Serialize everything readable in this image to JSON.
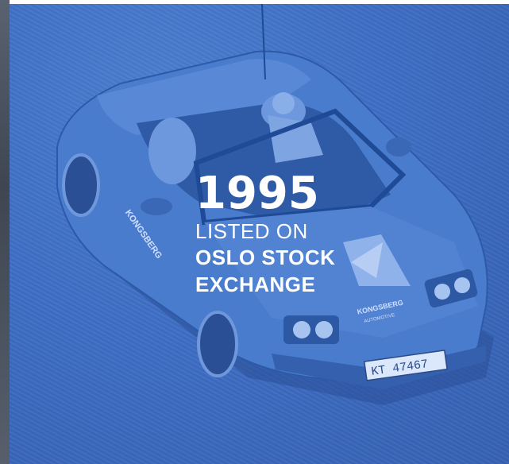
{
  "milestone": {
    "year": "1995",
    "line1": "LISTED ON",
    "line2": "OSLO STOCK",
    "line3": "EXCHANGE"
  },
  "photo": {
    "plate": "KT 47467",
    "brand_hood": "KONGSBERG",
    "brand_hood_sub": "AUTOMOTIVE",
    "brand_door": "KONGSBERG"
  },
  "colors": {
    "overlay_blue": "#3f6fc6",
    "text_white": "#ffffff",
    "edge_gray": "#4a515c"
  }
}
